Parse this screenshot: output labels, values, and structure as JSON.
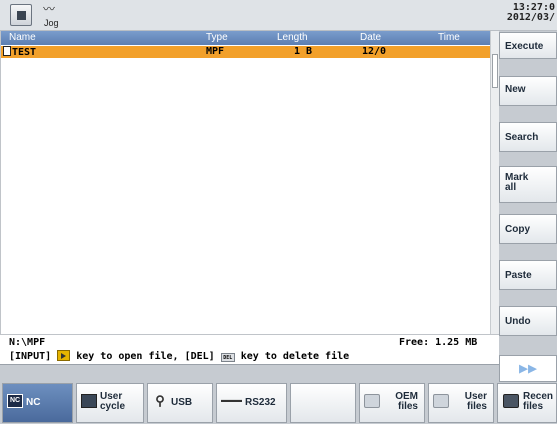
{
  "header": {
    "mode_icon": "nc-machine-icon",
    "jog_icon": "jog-wave-icon",
    "jog_label": "Jog",
    "time": "13:27:0",
    "date": "2012/03/"
  },
  "list": {
    "columns": [
      "Name",
      "Type",
      "Length",
      "Date",
      "Time"
    ],
    "rows": [
      {
        "name": "TEST",
        "type": "MPF",
        "length": "1 B",
        "date": "12/0",
        "time": ""
      }
    ]
  },
  "status": {
    "path": "N:\\MPF",
    "free": "Free: 1.25 MB",
    "hint_part1": "[INPUT]",
    "hint_part2": "key to open file, [DEL]",
    "del_icon_text": "DEL",
    "hint_part3": "key to delete file"
  },
  "vertical_softkeys": [
    {
      "label": "Execute"
    },
    {
      "label": "New"
    },
    {
      "label": "Search"
    },
    {
      "label": "Mark\nall"
    },
    {
      "label": "Copy"
    },
    {
      "label": "Paste"
    },
    {
      "label": "Undo"
    }
  ],
  "next_button": "▶▶",
  "horizontal_softkeys": [
    {
      "label": "NC",
      "icon": "nc-icon",
      "icon_text": "NC"
    },
    {
      "label": "User\ncycle",
      "icon": "user-cycle-icon"
    },
    {
      "label": "USB",
      "icon": "usb-icon"
    },
    {
      "label": "RS232",
      "icon": "rs232-icon",
      "icon_text": "▬▬▬"
    },
    {
      "label": "",
      "icon": ""
    },
    {
      "label": "OEM\nfiles",
      "icon": "folder-icon"
    },
    {
      "label": "User\nfiles",
      "icon": "folder-icon"
    },
    {
      "label": "Recen\nfiles",
      "icon": "recent-icon"
    }
  ],
  "colors": {
    "header_bg": "#dfe3e7",
    "column_header": "#6a8cbe",
    "selection": "#f2a02a",
    "softkey_text": "#1e2b3a",
    "active_softkey": "#5b7bad"
  }
}
